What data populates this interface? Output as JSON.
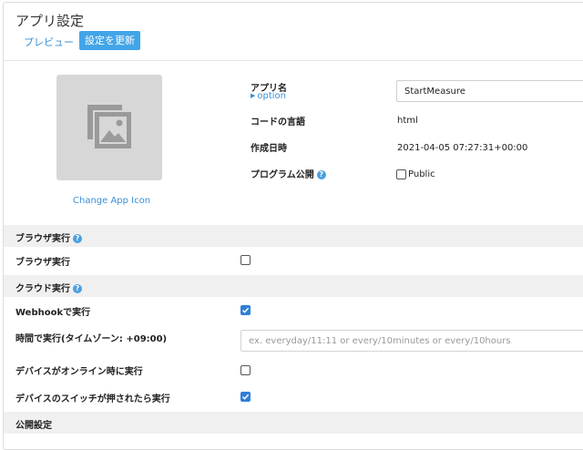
{
  "header": {
    "title": "アプリ設定",
    "preview_label": "プレビュー",
    "update_label": "設定を更新"
  },
  "icon_panel": {
    "change_icon_label": "Change App Icon"
  },
  "details": {
    "app_name_label": "アプリ名",
    "option_label": "option",
    "app_name_value": "StartMeasure",
    "code_lang_label": "コードの言語",
    "code_lang_value": "html",
    "created_label": "作成日時",
    "created_value": "2021-04-05 07:27:31+00:00",
    "publish_label": "プログラム公開",
    "public_label": "Public",
    "public_checked": false
  },
  "browser_section": {
    "title": "ブラウザ実行",
    "browser_run_label": "ブラウザ実行",
    "browser_run_checked": false
  },
  "cloud_section": {
    "title": "クラウド実行",
    "webhook_label": "Webhookで実行",
    "webhook_checked": true,
    "schedule_label": "時間で実行(タイムゾーン: +09:00)",
    "schedule_placeholder": "ex. everyday/11:11 or every/10minutes or every/10hours",
    "online_label": "デバイスがオンライン時に実行",
    "online_checked": false,
    "switch_label": "デバイスのスイッチが押されたら実行",
    "switch_checked": true
  },
  "public_section": {
    "title": "公開設定"
  },
  "colors": {
    "accent": "#42a5e8",
    "link": "#3a8fd6",
    "checkbox_checked": "#2f7fd8",
    "section_bg": "#f0f0f0"
  }
}
